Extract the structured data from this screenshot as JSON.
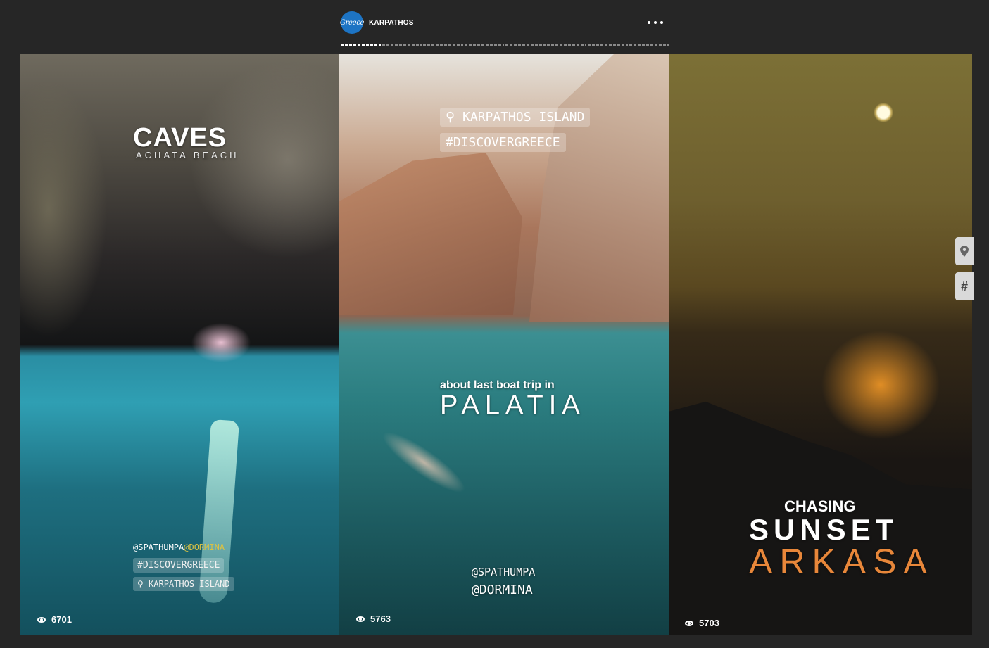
{
  "header": {
    "avatar_text": "Greece",
    "account_name": "KARPATHOS"
  },
  "progress": {
    "segments": 8,
    "active_index": 0
  },
  "stories": [
    {
      "title": "CAVES",
      "subtitle": "ACHATA BEACH",
      "mention_1": "@SPATHUMPA",
      "mention_2": "@DORMINA",
      "hashtag": "#DISCOVERGREECE",
      "location": "KARPATHOS ISLAND",
      "views": "6701"
    },
    {
      "location": "KARPATHOS ISLAND",
      "hashtag": "#DISCOVERGREECE",
      "caption": "about last boat trip in",
      "title": "PALATIA",
      "mention_1": "@SPATHUMPA",
      "mention_2": "@DORMINA",
      "views": "5763"
    },
    {
      "line_1": "CHASING",
      "line_2": "SUNSET",
      "line_3": "ARKASA",
      "views": "5703"
    }
  ],
  "side_stickers": {
    "location_icon": "location-pin-icon",
    "hashtag_label": "#"
  },
  "colors": {
    "background": "#262626",
    "accent_orange": "#e8873a",
    "mention_yellow": "#d9c145"
  }
}
